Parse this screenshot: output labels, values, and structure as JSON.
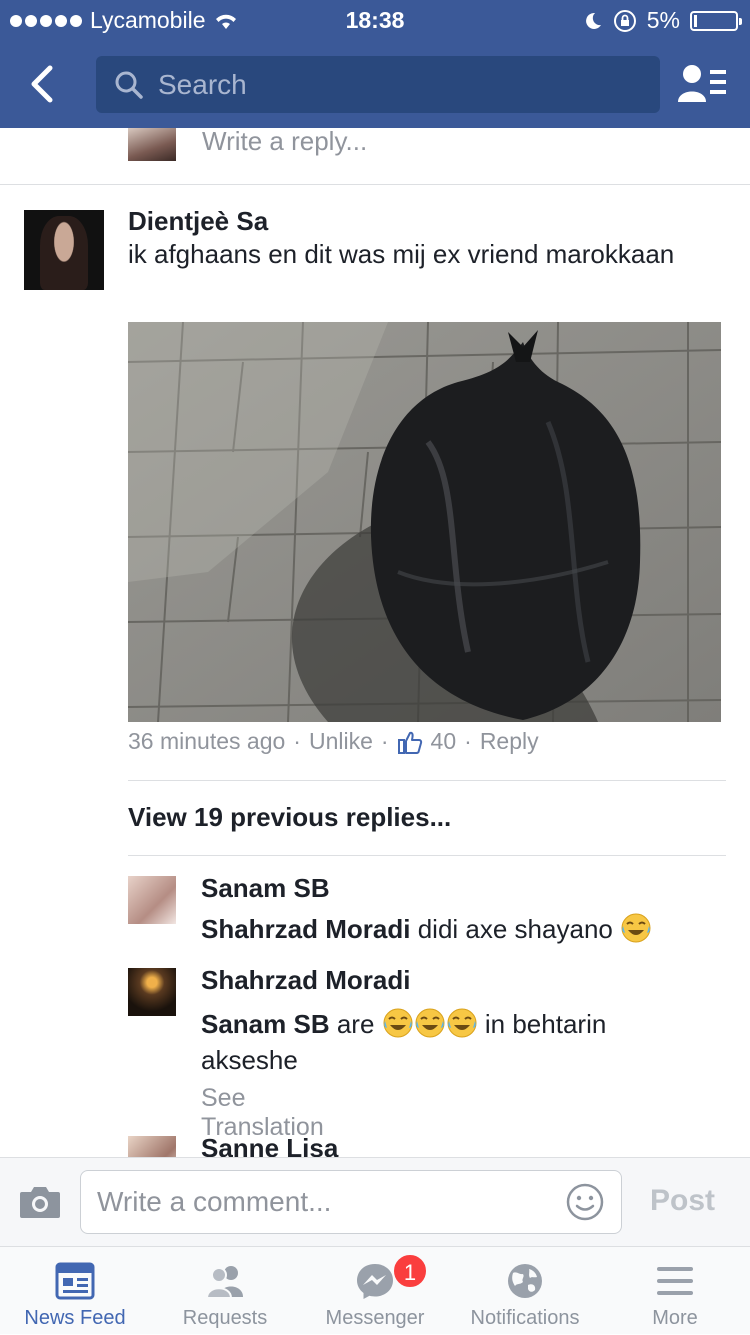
{
  "status_bar": {
    "carrier": "Lycamobile",
    "time": "18:38",
    "battery": "5%"
  },
  "nav": {
    "search_placeholder": "Search"
  },
  "reply_prompt": "Write a reply...",
  "comment": {
    "author": "Dientjeè Sa",
    "text": "ik afghaans en dit was mij ex vriend marokkaan",
    "time": "36 minutes ago",
    "unlike": "Unlike",
    "like_count": "40",
    "reply": "Reply"
  },
  "view_previous": "View 19 previous replies...",
  "replies": [
    {
      "author": "Sanam SB",
      "mention": "Shahrzad Moradi",
      "text": "didi axe shayano"
    },
    {
      "author": "Shahrzad Moradi",
      "mention": "Sanam SB",
      "text_before": "are",
      "text_after": "in behtarin akseshe",
      "see_translation": "See Translation"
    },
    {
      "author": "Sanne Lisa"
    }
  ],
  "composer": {
    "placeholder": "Write a comment...",
    "post": "Post"
  },
  "tabs": [
    {
      "label": "News Feed",
      "icon": "news-feed-icon",
      "active": true
    },
    {
      "label": "Requests",
      "icon": "requests-icon"
    },
    {
      "label": "Messenger",
      "icon": "messenger-icon",
      "badge": "1"
    },
    {
      "label": "Notifications",
      "icon": "globe-icon"
    },
    {
      "label": "More",
      "icon": "menu-icon"
    }
  ],
  "colors": {
    "brand": "#3b5998",
    "active_tab": "#4267b2",
    "badge": "#fa3e3e",
    "like_icon": "#4267b2"
  }
}
